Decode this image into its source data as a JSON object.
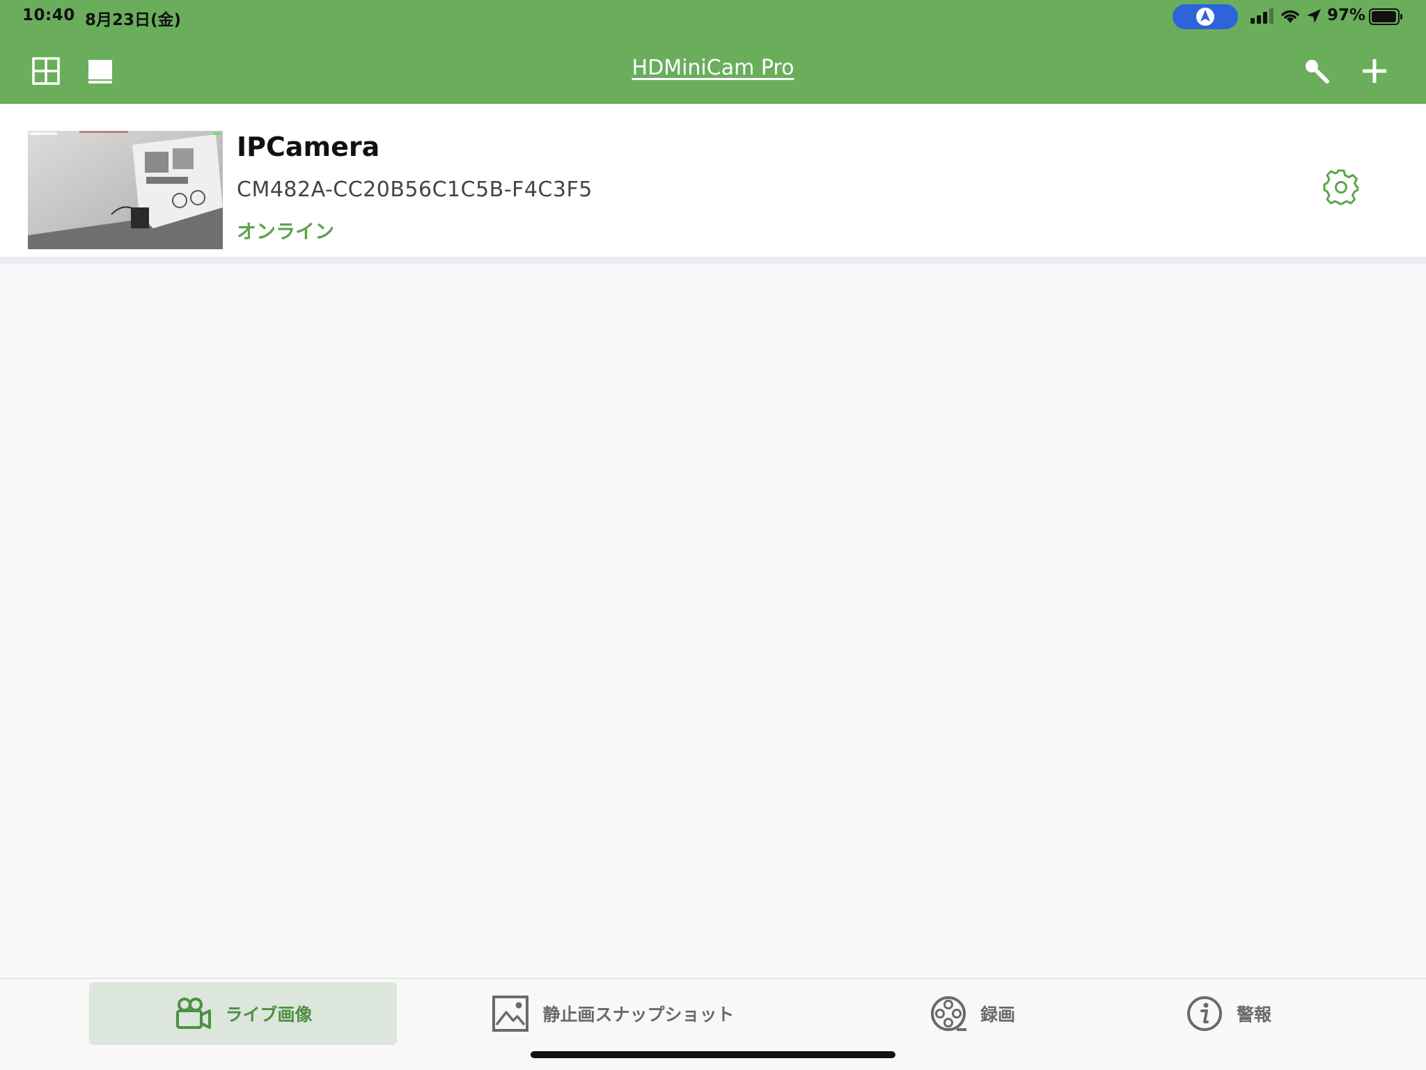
{
  "status_bar": {
    "time": "10:40",
    "date": "8月23日(金)",
    "battery_pct": "97%",
    "battery_level": 0.97,
    "icons": [
      "navigation-pill-icon",
      "signal-icon",
      "wifi-icon",
      "location-arrow-icon",
      "battery-icon"
    ]
  },
  "header": {
    "title": "HDMiniCam Pro",
    "left_icons": [
      "grid-view-icon",
      "single-view-icon"
    ],
    "right_icons": [
      "search-icon",
      "add-icon"
    ]
  },
  "cameras": [
    {
      "name": "IPCamera",
      "uid": "CM482A-CC20B56C1C5B-F4C3F5",
      "status": "オンライン",
      "settings_icon": "gear-icon"
    }
  ],
  "tabs": [
    {
      "label": "ライブ画像",
      "icon": "video-camera-icon",
      "active": true
    },
    {
      "label": "静止画スナップショット",
      "icon": "image-icon",
      "active": false
    },
    {
      "label": "録画",
      "icon": "film-reel-icon",
      "active": false
    },
    {
      "label": "警報",
      "icon": "info-icon",
      "active": false
    }
  ],
  "colors": {
    "header_bg": "#6aae5c",
    "accent_green": "#5aa54c",
    "active_tab_bg": "#dce6dc",
    "page_bg": "#f6f7f8"
  }
}
